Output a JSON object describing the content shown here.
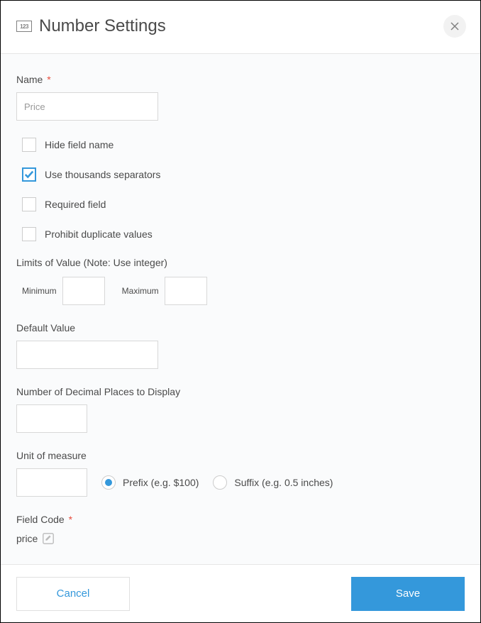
{
  "header": {
    "icon_text": "123",
    "title": "Number Settings"
  },
  "form": {
    "name": {
      "label": "Name",
      "value": "Price"
    },
    "checkboxes": {
      "hide_field_name": {
        "label": "Hide field name",
        "checked": false
      },
      "thousands_separators": {
        "label": "Use thousands separators",
        "checked": true
      },
      "required_field": {
        "label": "Required field",
        "checked": false
      },
      "prohibit_duplicates": {
        "label": "Prohibit duplicate values",
        "checked": false
      }
    },
    "limits": {
      "label": "Limits of Value (Note: Use integer)",
      "minimum_label": "Minimum",
      "minimum_value": "",
      "maximum_label": "Maximum",
      "maximum_value": ""
    },
    "default_value": {
      "label": "Default Value",
      "value": ""
    },
    "decimal_places": {
      "label": "Number of Decimal Places to Display",
      "value": ""
    },
    "unit": {
      "label": "Unit of measure",
      "value": "",
      "prefix_label": "Prefix (e.g. $100)",
      "suffix_label": "Suffix (e.g. 0.5 inches)",
      "selected": "prefix"
    },
    "field_code": {
      "label": "Field Code",
      "value": "price"
    }
  },
  "footer": {
    "cancel": "Cancel",
    "save": "Save"
  }
}
